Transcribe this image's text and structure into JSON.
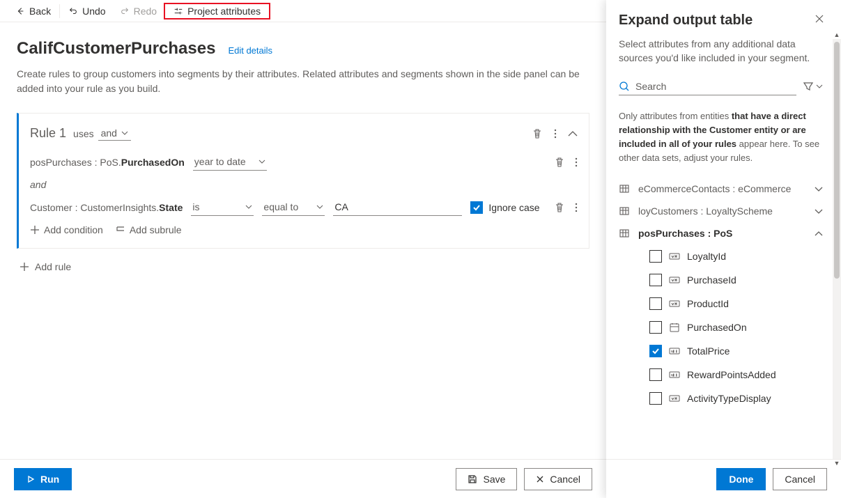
{
  "toolbar": {
    "back": "Back",
    "undo": "Undo",
    "redo": "Redo",
    "project_attributes": "Project attributes"
  },
  "page": {
    "title": "CalifCustomerPurchases",
    "edit_link": "Edit details",
    "description": "Create rules to group customers into segments by their attributes. Related attributes and segments shown in the side panel can be added into your rule as you build."
  },
  "rule": {
    "title": "Rule 1",
    "uses": "uses",
    "logic": "and",
    "cond1_prefix": "posPurchases : PoS.",
    "cond1_bold": "PurchasedOn",
    "cond1_operator": "year to date",
    "join": "and",
    "cond2_prefix": "Customer : CustomerInsights.",
    "cond2_bold": "State",
    "cond2_op1": "is",
    "cond2_op2": "equal to",
    "cond2_value": "CA",
    "ignore_case": "Ignore case",
    "add_condition": "Add condition",
    "add_subrule": "Add subrule"
  },
  "add_rule": "Add rule",
  "footer": {
    "run": "Run",
    "save": "Save",
    "cancel": "Cancel"
  },
  "panel": {
    "title": "Expand output table",
    "description": "Select attributes from any additional data sources you'd like included in your segment.",
    "search_placeholder": "Search",
    "hint_prefix": "Only attributes from entities ",
    "hint_bold1": "that have a direct relationship with the Customer entity or are included in all of your rules",
    "hint_suffix": " appear here. To see other data sets, adjust your rules.",
    "entities": [
      {
        "label": "eCommerceContacts : eCommerce",
        "expanded": false
      },
      {
        "label": "loyCustomers : LoyaltyScheme",
        "expanded": false
      },
      {
        "label": "posPurchases : PoS",
        "expanded": true
      }
    ],
    "attrs": [
      {
        "label": "LoyaltyId",
        "checked": false,
        "type": "text"
      },
      {
        "label": "PurchaseId",
        "checked": false,
        "type": "text"
      },
      {
        "label": "ProductId",
        "checked": false,
        "type": "text"
      },
      {
        "label": "PurchasedOn",
        "checked": false,
        "type": "date"
      },
      {
        "label": "TotalPrice",
        "checked": true,
        "type": "number"
      },
      {
        "label": "RewardPointsAdded",
        "checked": false,
        "type": "number"
      },
      {
        "label": "ActivityTypeDisplay",
        "checked": false,
        "type": "text"
      }
    ],
    "done": "Done",
    "cancel": "Cancel"
  }
}
